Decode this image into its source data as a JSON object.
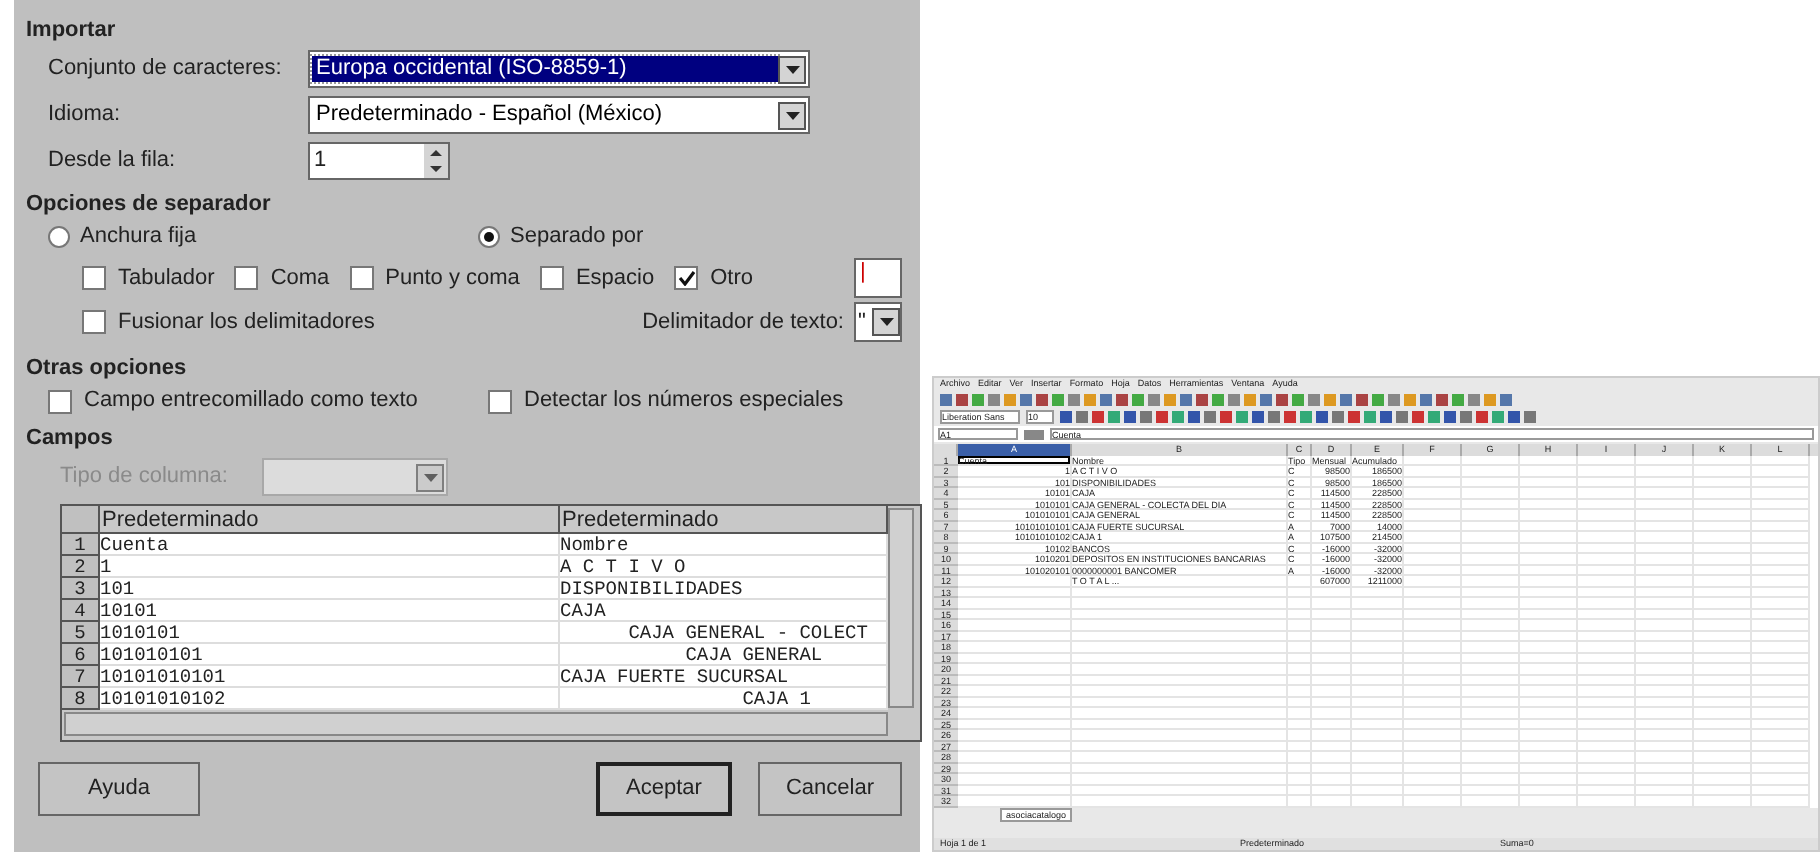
{
  "dialog": {
    "import": {
      "title": "Importar",
      "charset": {
        "label": "Conjunto de caracteres:",
        "value": "Europa occidental (ISO-8859-1)",
        "focused": true
      },
      "language": {
        "label": "Idioma:",
        "value": "Predeterminado - Español (México)",
        "focused": false
      },
      "from_row": {
        "label": "Desde la fila:",
        "value": "1"
      }
    },
    "separator": {
      "title": "Opciones de separador",
      "modes": [
        {
          "label": "Anchura fija",
          "selected": false
        },
        {
          "label": "Separado por",
          "selected": true
        }
      ],
      "delimiters": [
        {
          "label": "Tabulador",
          "checked": false
        },
        {
          "label": "Coma",
          "checked": false
        },
        {
          "label": "Punto y coma",
          "checked": false
        },
        {
          "label": "Espacio",
          "checked": false
        },
        {
          "label": "Otro",
          "checked": true
        }
      ],
      "other_value": "|",
      "merge": {
        "label": "Fusionar los delimitadores",
        "checked": false
      },
      "text_delimiter": {
        "label": "Delimitador de texto:",
        "value": "\""
      }
    },
    "other_options": {
      "title": "Otras opciones",
      "options": [
        {
          "label": "Campo entrecomillado como texto",
          "checked": false
        },
        {
          "label": "Detectar los números especiales",
          "checked": false
        }
      ]
    },
    "fields": {
      "title": "Campos",
      "column_type": {
        "label": "Tipo de columna:",
        "disabled": true
      },
      "columns": [
        "Predeterminado",
        "Predeterminado"
      ],
      "rows": [
        {
          "number": "1",
          "cells": [
            "Cuenta",
            "Nombre"
          ]
        },
        {
          "number": "2",
          "cells": [
            "1",
            "A C T I V O"
          ]
        },
        {
          "number": "3",
          "cells": [
            "101",
            "DISPONIBILIDADES"
          ]
        },
        {
          "number": "4",
          "cells": [
            "10101",
            "CAJA"
          ]
        },
        {
          "number": "5",
          "cells": [
            "1010101",
            "      CAJA GENERAL - COLECT"
          ]
        },
        {
          "number": "6",
          "cells": [
            "101010101",
            "           CAJA GENERAL"
          ]
        },
        {
          "number": "7",
          "cells": [
            "10101010101",
            "CAJA FUERTE SUCURSAL"
          ]
        },
        {
          "number": "8",
          "cells": [
            "10101010102",
            "                CAJA 1"
          ]
        }
      ]
    },
    "buttons": [
      {
        "label": "Ayuda",
        "default": false
      },
      {
        "label": "Aceptar",
        "default": true
      },
      {
        "label": "Cancelar",
        "default": false
      }
    ]
  },
  "spreadsheet": {
    "menu": [
      "Archivo",
      "Editar",
      "Ver",
      "Insertar",
      "Formato",
      "Hoja",
      "Datos",
      "Herramientas",
      "Ventana",
      "Ayuda"
    ],
    "font_name": "Liberation Sans",
    "font_size": "10",
    "cell_ref": "A1",
    "formula": "Cuenta",
    "columns": [
      "A",
      "B",
      "C",
      "D",
      "E",
      "F",
      "G",
      "H",
      "I",
      "J",
      "K",
      "L"
    ],
    "rows": [
      {
        "number": "1",
        "cells": [
          "Cuenta",
          "Nombre",
          "Tipo",
          "Mensual",
          "Acumulado"
        ]
      },
      {
        "number": "2",
        "cells": [
          "1",
          "A C T I V O",
          "C",
          "98500",
          "186500"
        ]
      },
      {
        "number": "3",
        "cells": [
          "101",
          "DISPONIBILIDADES",
          "C",
          "98500",
          "186500"
        ]
      },
      {
        "number": "4",
        "cells": [
          "10101",
          "CAJA",
          "C",
          "114500",
          "228500"
        ]
      },
      {
        "number": "5",
        "cells": [
          "1010101",
          "CAJA GENERAL - COLECTA DEL DIA",
          "C",
          "114500",
          "228500"
        ]
      },
      {
        "number": "6",
        "cells": [
          "101010101",
          "CAJA GENERAL",
          "C",
          "114500",
          "228500"
        ]
      },
      {
        "number": "7",
        "cells": [
          "10101010101",
          "CAJA FUERTE SUCURSAL",
          "A",
          "7000",
          "14000"
        ]
      },
      {
        "number": "8",
        "cells": [
          "10101010102",
          "CAJA 1",
          "A",
          "107500",
          "214500"
        ]
      },
      {
        "number": "9",
        "cells": [
          "10102",
          "BANCOS",
          "C",
          "-16000",
          "-32000"
        ]
      },
      {
        "number": "10",
        "cells": [
          "1010201",
          "DEPOSITOS EN INSTITUCIONES BANCARIAS",
          "C",
          "-16000",
          "-32000"
        ]
      },
      {
        "number": "11",
        "cells": [
          "101020101",
          "0000000001 BANCOMER",
          "A",
          "-16000",
          "-32000"
        ]
      },
      {
        "number": "12",
        "cells": [
          "",
          "T O T A L ...",
          "",
          "607000",
          "1211000"
        ]
      },
      {
        "number": "13",
        "cells": []
      },
      {
        "number": "14",
        "cells": []
      },
      {
        "number": "15",
        "cells": []
      },
      {
        "number": "16",
        "cells": []
      },
      {
        "number": "17",
        "cells": []
      },
      {
        "number": "18",
        "cells": []
      },
      {
        "number": "19",
        "cells": []
      },
      {
        "number": "20",
        "cells": []
      },
      {
        "number": "21",
        "cells": []
      },
      {
        "number": "22",
        "cells": []
      },
      {
        "number": "23",
        "cells": []
      },
      {
        "number": "24",
        "cells": []
      },
      {
        "number": "25",
        "cells": []
      },
      {
        "number": "26",
        "cells": []
      },
      {
        "number": "27",
        "cells": []
      },
      {
        "number": "28",
        "cells": []
      },
      {
        "number": "29",
        "cells": []
      },
      {
        "number": "30",
        "cells": []
      },
      {
        "number": "31",
        "cells": []
      },
      {
        "number": "32",
        "cells": []
      }
    ],
    "sheet_tab": "asociacatalogo",
    "status_bar": [
      "Hoja 1 de 1",
      "Predeterminado",
      "Suma=0"
    ]
  }
}
